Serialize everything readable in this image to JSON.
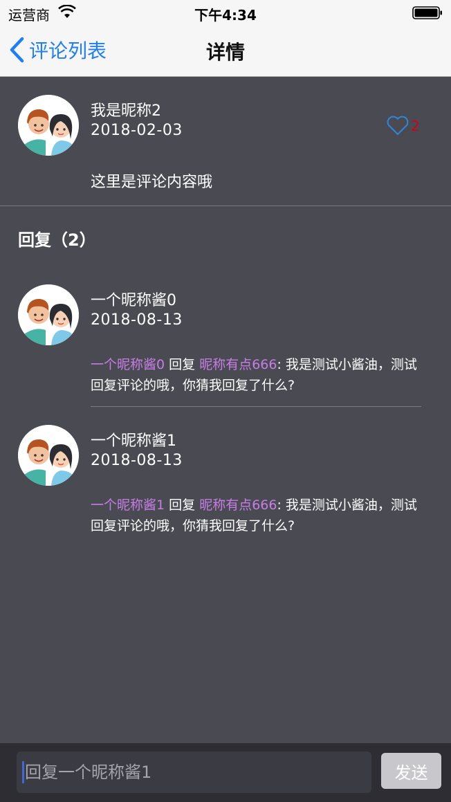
{
  "status_bar": {
    "carrier": "运营商",
    "time": "下午4:34"
  },
  "nav": {
    "back_label": "评论列表",
    "title": "详情"
  },
  "comment": {
    "nickname": "我是昵称2",
    "date": "2018-02-03",
    "like_count": "2",
    "text": "这里是评论内容哦"
  },
  "replies_header": "回复（2）",
  "replies": [
    {
      "nickname": "一个昵称酱0",
      "date": "2018-08-13",
      "from": "一个昵称酱0",
      "verb": " 回复 ",
      "to": "昵称有点666",
      "content": ": 我是测试小酱油，测试回复评论的哦，你猜我回复了什么?"
    },
    {
      "nickname": "一个昵称酱1",
      "date": "2018-08-13",
      "from": "一个昵称酱1",
      "verb": " 回复 ",
      "to": "昵称有点666",
      "content": ": 我是测试小酱油，测试回复评论的哦，你猜我回复了什么?"
    }
  ],
  "input": {
    "placeholder": "回复一个昵称酱1",
    "send_label": "发送"
  },
  "colors": {
    "accent": "#1e7ef5",
    "like": "#d0021b",
    "mention": "#c77de6",
    "background": "#4a4a52"
  },
  "icons": [
    "wifi-icon",
    "battery-icon",
    "back-chevron-icon",
    "heart-icon",
    "avatar"
  ]
}
